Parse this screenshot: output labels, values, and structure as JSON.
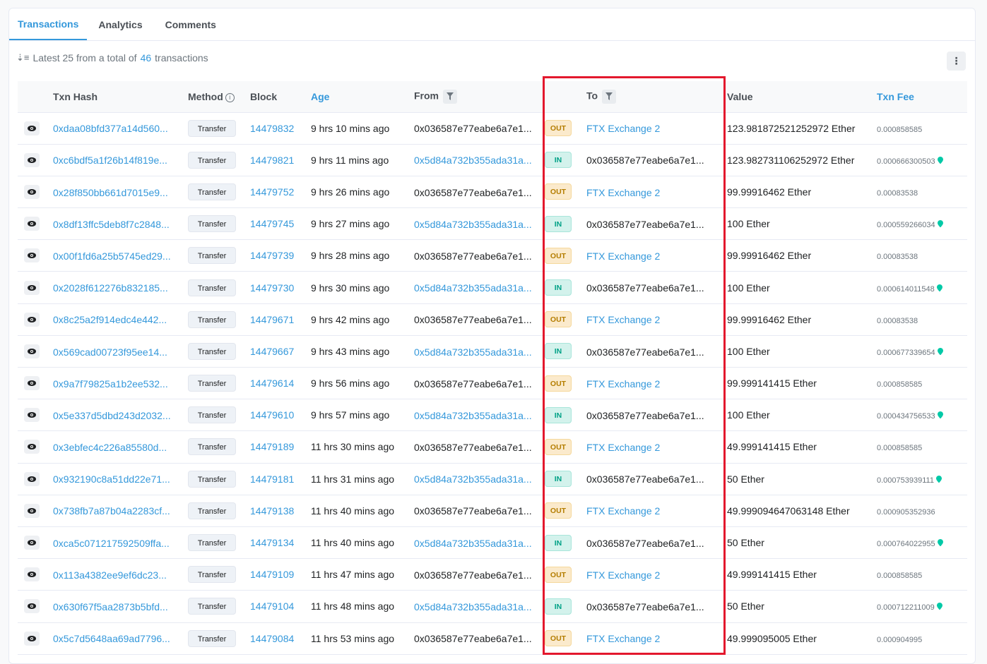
{
  "tabs": [
    {
      "label": "Transactions",
      "active": true
    },
    {
      "label": "Analytics",
      "active": false
    },
    {
      "label": "Comments",
      "active": false
    }
  ],
  "summary": {
    "prefix": "Latest 25 from a total of",
    "count": "46",
    "suffix": "transactions"
  },
  "columns": {
    "txn_hash": "Txn Hash",
    "method": "Method",
    "block": "Block",
    "age": "Age",
    "from": "From",
    "to": "To",
    "value": "Value",
    "txn_fee": "Txn Fee"
  },
  "colors": {
    "link": "#3498db",
    "out_bg": "#fbeacc",
    "in_bg": "#d3f2ec",
    "highlight": "#e3182d"
  },
  "rows": [
    {
      "hash": "0xdaa08bfd377a14d560...",
      "method": "Transfer",
      "block": "14479832",
      "age": "9 hrs 10 mins ago",
      "from": "0x036587e77eabe6a7e1...",
      "from_link": false,
      "dir": "OUT",
      "to": "FTX Exchange 2",
      "to_link": true,
      "value": "123.981872521252972 Ether",
      "fee": "0.000858585",
      "gas": false
    },
    {
      "hash": "0xc6bdf5a1f26b14f819e...",
      "method": "Transfer",
      "block": "14479821",
      "age": "9 hrs 11 mins ago",
      "from": "0x5d84a732b355ada31a...",
      "from_link": true,
      "dir": "IN",
      "to": "0x036587e77eabe6a7e1...",
      "to_link": false,
      "value": "123.982731106252972 Ether",
      "fee": "0.000666300503",
      "gas": true
    },
    {
      "hash": "0x28f850bb661d7015e9...",
      "method": "Transfer",
      "block": "14479752",
      "age": "9 hrs 26 mins ago",
      "from": "0x036587e77eabe6a7e1...",
      "from_link": false,
      "dir": "OUT",
      "to": "FTX Exchange 2",
      "to_link": true,
      "value": "99.99916462 Ether",
      "fee": "0.00083538",
      "gas": false
    },
    {
      "hash": "0x8df13ffc5deb8f7c2848...",
      "method": "Transfer",
      "block": "14479745",
      "age": "9 hrs 27 mins ago",
      "from": "0x5d84a732b355ada31a...",
      "from_link": true,
      "dir": "IN",
      "to": "0x036587e77eabe6a7e1...",
      "to_link": false,
      "value": "100 Ether",
      "fee": "0.000559266034",
      "gas": true
    },
    {
      "hash": "0x00f1fd6a25b5745ed29...",
      "method": "Transfer",
      "block": "14479739",
      "age": "9 hrs 28 mins ago",
      "from": "0x036587e77eabe6a7e1...",
      "from_link": false,
      "dir": "OUT",
      "to": "FTX Exchange 2",
      "to_link": true,
      "value": "99.99916462 Ether",
      "fee": "0.00083538",
      "gas": false
    },
    {
      "hash": "0x2028f612276b832185...",
      "method": "Transfer",
      "block": "14479730",
      "age": "9 hrs 30 mins ago",
      "from": "0x5d84a732b355ada31a...",
      "from_link": true,
      "dir": "IN",
      "to": "0x036587e77eabe6a7e1...",
      "to_link": false,
      "value": "100 Ether",
      "fee": "0.000614011548",
      "gas": true
    },
    {
      "hash": "0x8c25a2f914edc4e442...",
      "method": "Transfer",
      "block": "14479671",
      "age": "9 hrs 42 mins ago",
      "from": "0x036587e77eabe6a7e1...",
      "from_link": false,
      "dir": "OUT",
      "to": "FTX Exchange 2",
      "to_link": true,
      "value": "99.99916462 Ether",
      "fee": "0.00083538",
      "gas": false
    },
    {
      "hash": "0x569cad00723f95ee14...",
      "method": "Transfer",
      "block": "14479667",
      "age": "9 hrs 43 mins ago",
      "from": "0x5d84a732b355ada31a...",
      "from_link": true,
      "dir": "IN",
      "to": "0x036587e77eabe6a7e1...",
      "to_link": false,
      "value": "100 Ether",
      "fee": "0.000677339654",
      "gas": true
    },
    {
      "hash": "0x9a7f79825a1b2ee532...",
      "method": "Transfer",
      "block": "14479614",
      "age": "9 hrs 56 mins ago",
      "from": "0x036587e77eabe6a7e1...",
      "from_link": false,
      "dir": "OUT",
      "to": "FTX Exchange 2",
      "to_link": true,
      "value": "99.999141415 Ether",
      "fee": "0.000858585",
      "gas": false
    },
    {
      "hash": "0x5e337d5dbd243d2032...",
      "method": "Transfer",
      "block": "14479610",
      "age": "9 hrs 57 mins ago",
      "from": "0x5d84a732b355ada31a...",
      "from_link": true,
      "dir": "IN",
      "to": "0x036587e77eabe6a7e1...",
      "to_link": false,
      "value": "100 Ether",
      "fee": "0.000434756533",
      "gas": true
    },
    {
      "hash": "0x3ebfec4c226a85580d...",
      "method": "Transfer",
      "block": "14479189",
      "age": "11 hrs 30 mins ago",
      "from": "0x036587e77eabe6a7e1...",
      "from_link": false,
      "dir": "OUT",
      "to": "FTX Exchange 2",
      "to_link": true,
      "value": "49.999141415 Ether",
      "fee": "0.000858585",
      "gas": false
    },
    {
      "hash": "0x932190c8a51dd22e71...",
      "method": "Transfer",
      "block": "14479181",
      "age": "11 hrs 31 mins ago",
      "from": "0x5d84a732b355ada31a...",
      "from_link": true,
      "dir": "IN",
      "to": "0x036587e77eabe6a7e1...",
      "to_link": false,
      "value": "50 Ether",
      "fee": "0.000753939111",
      "gas": true
    },
    {
      "hash": "0x738fb7a87b04a2283cf...",
      "method": "Transfer",
      "block": "14479138",
      "age": "11 hrs 40 mins ago",
      "from": "0x036587e77eabe6a7e1...",
      "from_link": false,
      "dir": "OUT",
      "to": "FTX Exchange 2",
      "to_link": true,
      "value": "49.999094647063148 Ether",
      "fee": "0.000905352936",
      "gas": false
    },
    {
      "hash": "0xca5c071217592509ffa...",
      "method": "Transfer",
      "block": "14479134",
      "age": "11 hrs 40 mins ago",
      "from": "0x5d84a732b355ada31a...",
      "from_link": true,
      "dir": "IN",
      "to": "0x036587e77eabe6a7e1...",
      "to_link": false,
      "value": "50 Ether",
      "fee": "0.000764022955",
      "gas": true
    },
    {
      "hash": "0x113a4382ee9ef6dc23...",
      "method": "Transfer",
      "block": "14479109",
      "age": "11 hrs 47 mins ago",
      "from": "0x036587e77eabe6a7e1...",
      "from_link": false,
      "dir": "OUT",
      "to": "FTX Exchange 2",
      "to_link": true,
      "value": "49.999141415 Ether",
      "fee": "0.000858585",
      "gas": false
    },
    {
      "hash": "0x630f67f5aa2873b5bfd...",
      "method": "Transfer",
      "block": "14479104",
      "age": "11 hrs 48 mins ago",
      "from": "0x5d84a732b355ada31a...",
      "from_link": true,
      "dir": "IN",
      "to": "0x036587e77eabe6a7e1...",
      "to_link": false,
      "value": "50 Ether",
      "fee": "0.000712211009",
      "gas": true
    },
    {
      "hash": "0x5c7d5648aa69ad7796...",
      "method": "Transfer",
      "block": "14479084",
      "age": "11 hrs 53 mins ago",
      "from": "0x036587e77eabe6a7e1...",
      "from_link": false,
      "dir": "OUT",
      "to": "FTX Exchange 2",
      "to_link": true,
      "value": "49.999095005 Ether",
      "fee": "0.000904995",
      "gas": false
    }
  ]
}
